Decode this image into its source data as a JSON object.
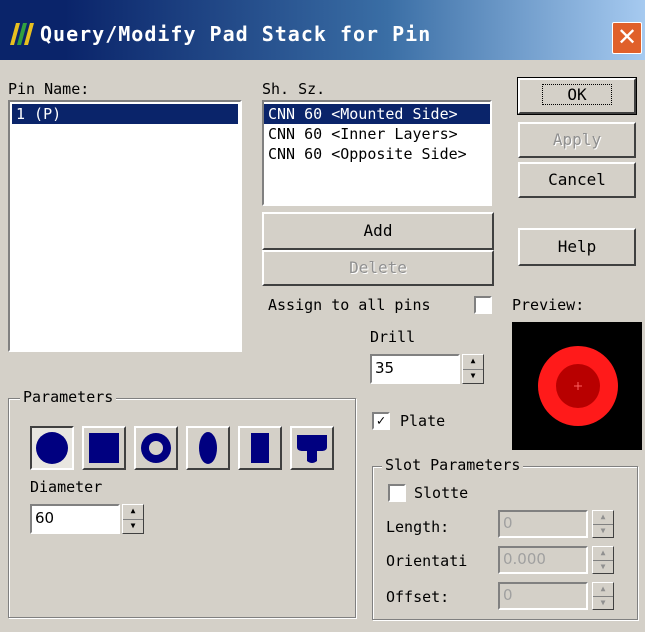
{
  "window": {
    "title": "Query/Modify Pad Stack for Pin",
    "close_glyph": "✕"
  },
  "pin_name": {
    "label": "Pin Name:",
    "items": [
      "1 (P)"
    ],
    "selected_index": 0
  },
  "sh_sz": {
    "label": "Sh. Sz.",
    "items": [
      "CNN 60 <Mounted Side>",
      "CNN 60 <Inner Layers>",
      "CNN 60 <Opposite Side>"
    ],
    "selected_index": 0
  },
  "buttons": {
    "ok": "OK",
    "apply": "Apply",
    "cancel": "Cancel",
    "help": "Help",
    "add": "Add",
    "delete": "Delete"
  },
  "assign_all": {
    "label": "Assign to all pins",
    "checked": false
  },
  "preview": {
    "label": "Preview:",
    "pad_color": "#ff2020",
    "hole_color": "#c00000",
    "background": "#000000"
  },
  "drill": {
    "label": "Drill",
    "value": "35"
  },
  "plate": {
    "label": "Plate",
    "checked": true
  },
  "parameters": {
    "title": "Parameters",
    "shapes": [
      "round-pad-icon",
      "square-pad-icon",
      "annular-pad-icon",
      "oval-pad-icon",
      "rectangle-pad-icon",
      "thermal-pad-icon"
    ],
    "selected_shape": 0,
    "diameter_label": "Diameter",
    "diameter_value": "60"
  },
  "slot": {
    "title": "Slot Parameters",
    "slotted_label": "Slotte",
    "slotted_checked": false,
    "length_label": "Length:",
    "length_value": "0",
    "orientation_label": "Orientati",
    "orientation_value": "0.000",
    "offset_label": "Offset:",
    "offset_value": "0"
  }
}
